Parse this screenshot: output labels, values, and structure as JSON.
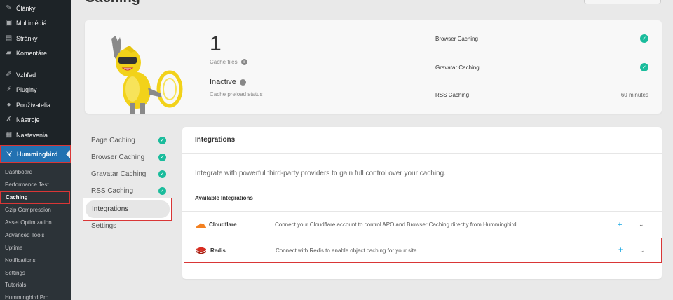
{
  "sidebar": {
    "items": [
      {
        "label": "Články",
        "icon": "pin-icon"
      },
      {
        "label": "Multimédiá",
        "icon": "media-icon"
      },
      {
        "label": "Stránky",
        "icon": "pages-icon"
      },
      {
        "label": "Komentáre",
        "icon": "comment-icon"
      },
      {
        "label": "Vzhľad",
        "icon": "brush-icon"
      },
      {
        "label": "Pluginy",
        "icon": "plug-icon"
      },
      {
        "label": "Používatelia",
        "icon": "user-icon"
      },
      {
        "label": "Nástroje",
        "icon": "wrench-icon"
      },
      {
        "label": "Nastavenia",
        "icon": "settings-icon"
      }
    ],
    "active": {
      "label": "Hummingbird",
      "icon": "hummingbird-icon"
    },
    "submenu": [
      "Dashboard",
      "Performance Test",
      "Caching",
      "Gzip Compression",
      "Asset Optimization",
      "Advanced Tools",
      "Uptime",
      "Notifications",
      "Settings",
      "Tutorials",
      "Hummingbird Pro"
    ]
  },
  "page": {
    "title": "Caching"
  },
  "summary": {
    "cache_files_value": "1",
    "cache_files_label": "Cache files",
    "preload_value": "Inactive",
    "preload_label": "Cache preload status",
    "rows": [
      {
        "label": "Browser Caching",
        "value": ""
      },
      {
        "label": "Gravatar Caching",
        "value": ""
      },
      {
        "label": "RSS Caching",
        "value": "60 minutes"
      }
    ]
  },
  "nav": {
    "items": [
      "Page Caching",
      "Browser Caching",
      "Gravatar Caching",
      "RSS Caching",
      "Integrations",
      "Settings"
    ]
  },
  "integrations": {
    "title": "Integrations",
    "description": "Integrate with powerful third-party providers to gain full control over your caching.",
    "available_label": "Available Integrations",
    "cloudflare": {
      "name": "Cloudflare",
      "desc": "Connect your Cloudflare account to control APO and Browser Caching directly from Hummingbird."
    },
    "redis": {
      "name": "Redis",
      "desc": "Connect with Redis to enable object caching for your site."
    },
    "plus": "+",
    "chevron": "⌄"
  },
  "colors": {
    "accent": "#2271b1",
    "success": "#1abc9c",
    "highlight": "#d93636",
    "sidebar_bg": "#1d2327"
  }
}
